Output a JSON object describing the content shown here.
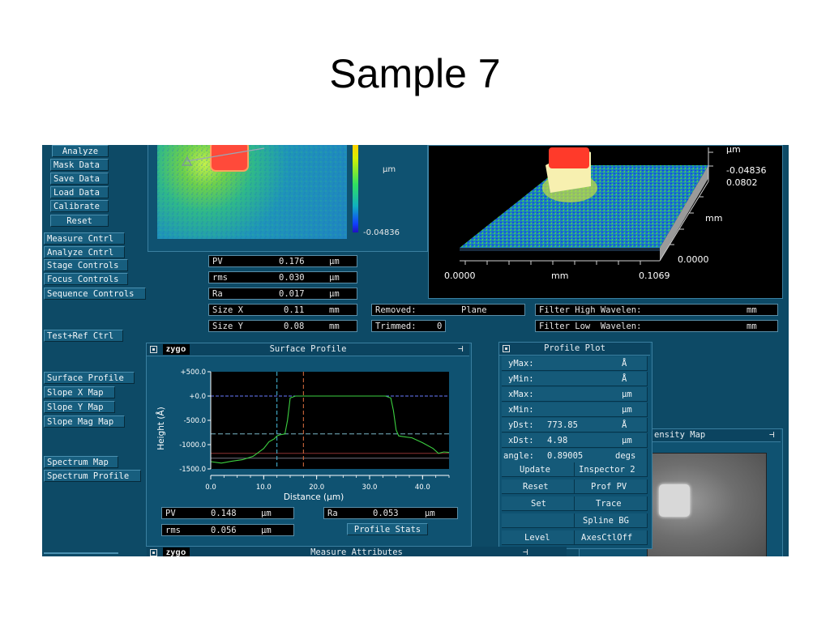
{
  "slide": {
    "title": "Sample 7"
  },
  "left_buttons": {
    "analyze": "Analyze",
    "mask_data": "Mask Data",
    "save_data": "Save Data",
    "load_data": "Load Data",
    "calibrate": "Calibrate",
    "reset": "Reset",
    "measure_cntrl": "Measure Cntrl",
    "analyze_cntrl": "Analyze Cntrl",
    "stage_controls": "Stage Controls",
    "focus_controls": "Focus Controls",
    "sequence_controls": "Sequence Controls",
    "test_ref_ctrl": "Test+Ref Ctrl",
    "surface_profile": "Surface Profile",
    "slope_x_map": "Slope X Map",
    "slope_y_map": "Slope Y Map",
    "slope_mag_map": "Slope Mag Map",
    "spectrum_map": "Spectrum Map",
    "spectrum_profile": "Spectrum Profile"
  },
  "colormap": {
    "unit": "µm",
    "min": "-0.04836"
  },
  "stats": {
    "pv": {
      "label": "PV",
      "value": "0.176",
      "unit": "µm"
    },
    "rms": {
      "label": "rms",
      "value": "0.030",
      "unit": "µm"
    },
    "ra": {
      "label": "Ra",
      "value": "0.017",
      "unit": "µm"
    },
    "size_x": {
      "label": "Size X",
      "value": "0.11",
      "unit": "mm"
    },
    "size_y": {
      "label": "Size Y",
      "value": "0.08",
      "unit": "mm"
    }
  },
  "removed": {
    "label": "Removed:",
    "value": "Plane"
  },
  "trimmed": {
    "label": "Trimmed:",
    "value": "0"
  },
  "filter_high": {
    "label": "Filter High Wavelen:",
    "unit": "mm"
  },
  "filter_low": {
    "label": "Filter Low  Wavelen:",
    "unit": "mm"
  },
  "plot3d": {
    "unit": "µm",
    "zmin": "-0.04836",
    "zmax": "0.0802",
    "y_unit": "mm",
    "y_label": "0.0000",
    "x_min": "0.0000",
    "x_unit": "mm",
    "x_max": "0.1069"
  },
  "surface_profile": {
    "title": "Surface Profile",
    "logo": "zygo",
    "pv": {
      "label": "PV",
      "value": "0.148",
      "unit": "µm"
    },
    "rms": {
      "label": "rms",
      "value": "0.056",
      "unit": "µm"
    },
    "ra": {
      "label": "Ra",
      "value": "0.053",
      "unit": "µm"
    },
    "stats_button": "Profile Stats"
  },
  "chart_data": {
    "type": "line",
    "xlabel": "Distance (µm)",
    "ylabel": "Height (Å)",
    "xlim": [
      0,
      45
    ],
    "ylim": [
      -1500,
      500
    ],
    "x_ticks": [
      "0.0",
      "10.0",
      "20.0",
      "30.0",
      "40.0"
    ],
    "y_ticks": [
      "+500.0",
      "+0.0",
      "-500.0",
      "-1000.0",
      "-1500.0"
    ],
    "series": [
      {
        "x": [
          0,
          2,
          4,
          6,
          8,
          10,
          11,
          12,
          12.5,
          13,
          14,
          14.5,
          15,
          16,
          20,
          25,
          30,
          33,
          34,
          34.5,
          35,
          35.5,
          36,
          38,
          40,
          42,
          43,
          44,
          45
        ],
        "y": [
          -1350,
          -1380,
          -1340,
          -1310,
          -1240,
          -1080,
          -940,
          -880,
          -820,
          -800,
          -780,
          -500,
          -40,
          0,
          0,
          0,
          0,
          0,
          -40,
          -300,
          -700,
          -820,
          -830,
          -860,
          -960,
          -1080,
          -1180,
          -1150,
          -1160
        ]
      }
    ],
    "reference_lines": [
      0,
      -780,
      -1180,
      -1280
    ],
    "cursors_x": [
      12.5,
      17.5
    ]
  },
  "profile_plot": {
    "title": "Profile Plot",
    "rows": [
      {
        "label": "yMax:",
        "value": "",
        "unit": "Å"
      },
      {
        "label": "yMin:",
        "value": "",
        "unit": "Å"
      },
      {
        "label": "xMax:",
        "value": "",
        "unit": "µm"
      },
      {
        "label": "xMin:",
        "value": "",
        "unit": "µm"
      },
      {
        "label": "yDst:",
        "value": "773.85",
        "unit": "Å"
      },
      {
        "label": "xDst:",
        "value": "4.98",
        "unit": "µm"
      },
      {
        "label": "angle:",
        "value": "0.89005",
        "unit": "degs"
      }
    ],
    "buttons": {
      "update": "Update",
      "inspector": "Inspector 2",
      "reset": "Reset",
      "prof_pv": "Prof PV",
      "set": "Set",
      "trace": "Trace",
      "spline_bg": "Spline BG",
      "level": "Level",
      "axes_ctl_off": "AxesCtlOff"
    }
  },
  "intensity_map": {
    "title": "ensity Map"
  },
  "measure_attributes": {
    "title": "Measure Attributes",
    "logo": "zygo"
  }
}
